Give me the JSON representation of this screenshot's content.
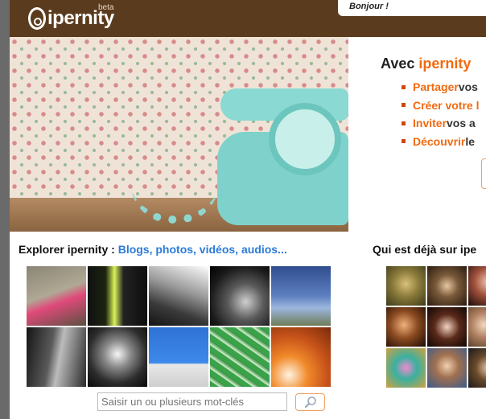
{
  "header": {
    "logo_text": "ipernity",
    "logo_badge": "beta",
    "greeting": "Bonjour !"
  },
  "promo": {
    "title_prefix": "Avec",
    "title_brand": "ipernity",
    "items": [
      {
        "highlight": "Partager",
        "rest": " vos"
      },
      {
        "highlight": "Créer votre l",
        "rest": ""
      },
      {
        "highlight": "Inviter",
        "rest": " vos a"
      },
      {
        "highlight": "Découvrir",
        "rest": " le"
      }
    ]
  },
  "explore": {
    "title_prefix": "Explorer ipernity :",
    "title_link": "Blogs, photos, vidéos, audios..."
  },
  "search": {
    "placeholder": "Saisir un ou plusieurs mot-clés"
  },
  "who": {
    "title": "Qui est déjà sur ipe"
  },
  "colors": {
    "header_bg": "#5b3b1d",
    "accent": "#f26a10",
    "link": "#2b7bd8",
    "bullet": "#d0460a"
  },
  "icons": {
    "search_button": "magnifier-icon"
  }
}
